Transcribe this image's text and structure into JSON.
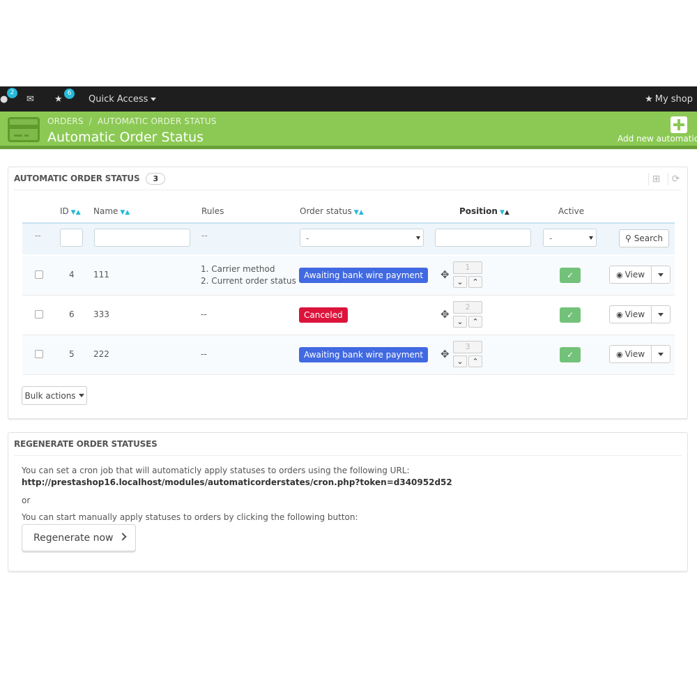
{
  "topbar": {
    "customers_badge": "2",
    "messages_icon": "envelope-icon",
    "orders_badge": "6",
    "quick_access": "Quick Access",
    "my_shop": "My shop"
  },
  "header": {
    "breadcrumb_parent": "ORDERS",
    "breadcrumb_current": "AUTOMATIC ORDER STATUS",
    "title": "Automatic Order Status",
    "add_label": "Add new automatic o",
    "accent": "#8bc954"
  },
  "list_panel": {
    "title": "AUTOMATIC ORDER STATUS",
    "count": "3",
    "columns": {
      "id": "ID",
      "name": "Name",
      "rules": "Rules",
      "order_status": "Order status",
      "position": "Position",
      "active": "Active"
    },
    "filters": {
      "id_placeholder": "--",
      "rules_placeholder": "--",
      "order_status_value": "-",
      "active_value": "-",
      "search_label": "Search"
    },
    "rows": [
      {
        "id": "4",
        "name": "111",
        "rules": [
          "1. Carrier method",
          "2. Current order status"
        ],
        "status": "Awaiting bank wire payment",
        "status_color": "#4169e1",
        "position": "1",
        "view_label": "View"
      },
      {
        "id": "6",
        "name": "333",
        "rules": [
          "--"
        ],
        "status": "Canceled",
        "status_color": "#dc143c",
        "position": "2",
        "view_label": "View"
      },
      {
        "id": "5",
        "name": "222",
        "rules": [
          "--"
        ],
        "status": "Awaiting bank wire payment",
        "status_color": "#4169e1",
        "position": "3",
        "view_label": "View"
      }
    ],
    "bulk_actions": "Bulk actions"
  },
  "regen_panel": {
    "title": "REGENERATE ORDER STATUSES",
    "cron_text": "You can set a cron job that will automaticly apply statuses to orders using the following URL:",
    "cron_url": "http://prestashop16.localhost/modules/automaticorderstates/cron.php?token=d340952d52",
    "or_text": "or",
    "manual_text": "You can start manually apply statuses to orders by clicking the following button:",
    "button_label": "Regenerate now"
  }
}
